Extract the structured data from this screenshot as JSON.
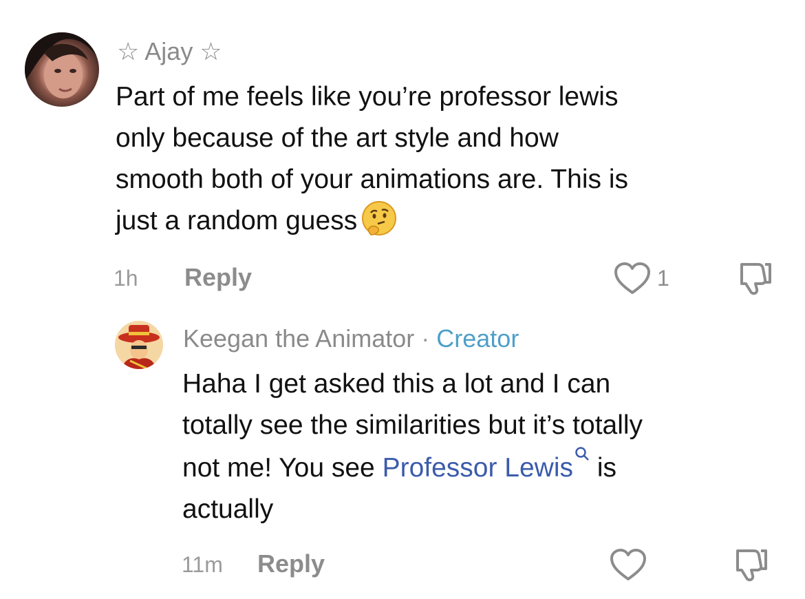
{
  "comment": {
    "author_prefix": "☆",
    "author_name": "Ajay",
    "author_suffix": "☆",
    "text_lines": [
      "Part of me feels like you’re professor lewis",
      "only because of the art style and how",
      "smooth both of your animations are. This is",
      "just a random guess"
    ],
    "emoji": "thinking-face-icon",
    "time": "1h",
    "reply_label": "Reply",
    "like_count": "1"
  },
  "reply": {
    "author_name": "Keegan the Animator",
    "separator": "·",
    "badge": "Creator",
    "text_lines": [
      "Haha I get asked this a lot and I can",
      "totally see the similarities but it’s totally"
    ],
    "line3_before": "not me! You see ",
    "line3_link": "Professor Lewis",
    "line3_after": " is",
    "line4": "actually",
    "time": "11m",
    "reply_label": "Reply"
  },
  "colors": {
    "link": "#3b5bab",
    "creator_badge": "#4e9fc9",
    "meta_gray": "#9a9a9a"
  }
}
